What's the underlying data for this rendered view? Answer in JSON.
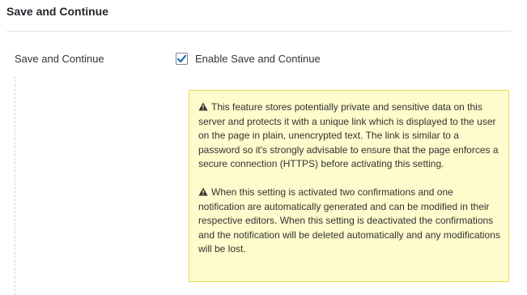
{
  "section": {
    "title": "Save and Continue"
  },
  "field": {
    "label": "Save and Continue",
    "checkbox": {
      "label": "Enable Save and Continue",
      "checked": true,
      "accent_color": "#2271b1"
    }
  },
  "notice": {
    "icon": "warning-icon",
    "paragraphs": [
      "This feature stores potentially private and sensitive data on this server and protects it with a unique link which is displayed to the user on the page in plain, unencrypted text. The link is similar to a password so it's strongly advisable to ensure that the page enforces a secure connection (HTTPS) before activating this setting.",
      "When this setting is activated two confirmations and one notification are automatically generated and can be modified in their respective editors. When this setting is deactivated the confirmations and the notification will be deleted automatically and any modifications will be lost."
    ],
    "background_color": "#fffbcc",
    "border_color": "#e6db55"
  }
}
